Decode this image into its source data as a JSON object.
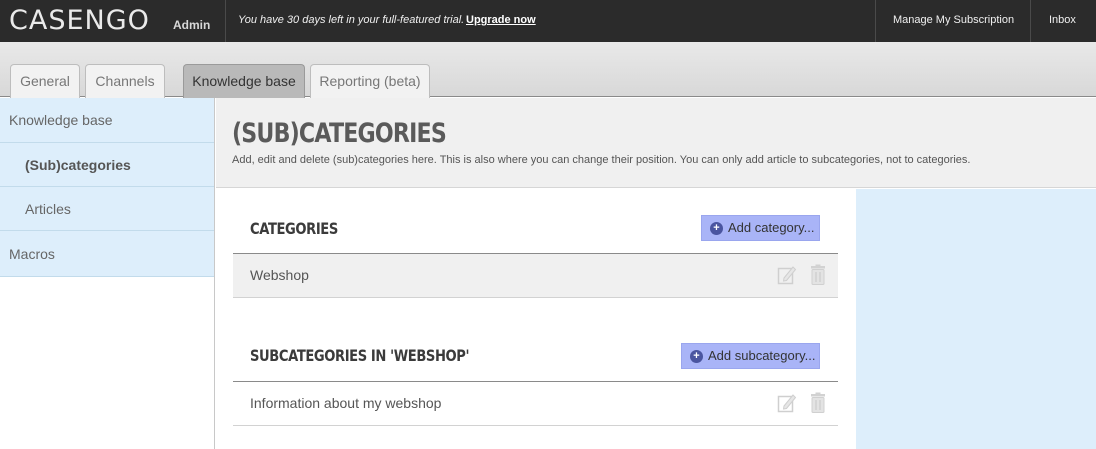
{
  "topbar": {
    "logo": "CASENGO",
    "logo_sub": "Admin",
    "trial_text": "You have 30 days left in your full-featured trial.",
    "upgrade_link": "Upgrade now",
    "manage_subscription": "Manage My Subscription",
    "inbox": "Inbox"
  },
  "tabs": [
    {
      "label": "General"
    },
    {
      "label": "Channels"
    },
    {
      "label": "Knowledge base"
    },
    {
      "label": "Reporting (beta)"
    }
  ],
  "sidebar": {
    "items": [
      {
        "label": "Knowledge base"
      },
      {
        "label": "(Sub)categories"
      },
      {
        "label": "Articles"
      },
      {
        "label": "Macros"
      }
    ]
  },
  "page": {
    "title": "(SUB)CATEGORIES",
    "description": "Add, edit and delete (sub)categories here. This is also where you can change their position. You can only add article to subcategories, not to categories."
  },
  "categories": {
    "title": "CATEGORIES",
    "add_label": "Add category...",
    "rows": [
      {
        "label": "Webshop"
      }
    ]
  },
  "subcategories": {
    "title": "SUBCATEGORIES IN 'WEBSHOP'",
    "add_label": "Add subcategory...",
    "rows": [
      {
        "label": "Information about my webshop"
      }
    ]
  },
  "icons": {
    "edit": "edit-icon",
    "delete": "trash-icon",
    "add": "plus-circle-icon"
  },
  "colors": {
    "topbar": "#2b2b2b",
    "sidebar_bg": "#ddeefb",
    "add_button": "#a9b4f7",
    "active_tab": "#b9b9b9"
  }
}
